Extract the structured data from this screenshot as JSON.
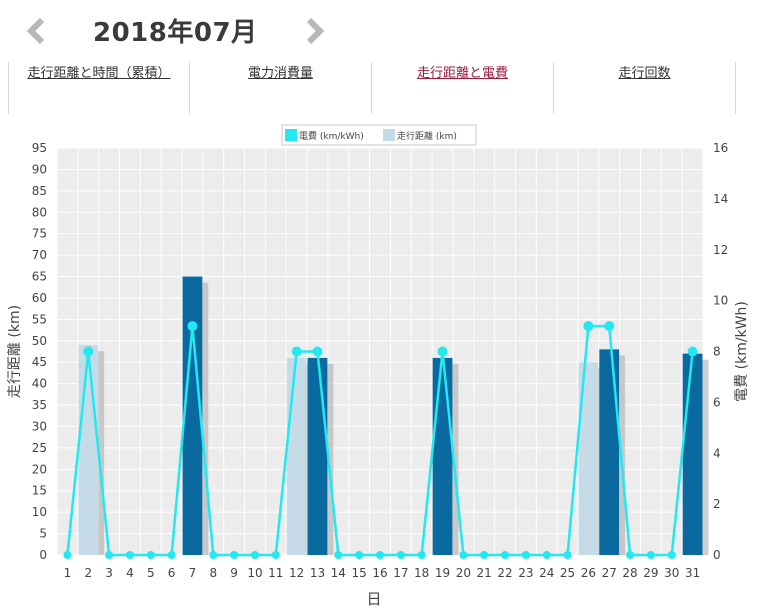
{
  "header": {
    "month_title": "2018年07月",
    "prev_icon": "chevron-left-icon",
    "next_icon": "chevron-right-icon"
  },
  "tabs": [
    {
      "label": "走行距離と時間（累積）",
      "active": false
    },
    {
      "label": "電力消費量",
      "active": false
    },
    {
      "label": "走行距離と電費",
      "active": true
    },
    {
      "label": "走行回数",
      "active": false
    }
  ],
  "colors": {
    "tab_text": "#333333",
    "tab_active": "#9b1c3c",
    "bar_dark": "#0a6aa0",
    "bar_light": "#c6dbe8",
    "line": "#22e8f0",
    "plot_bg": "#ececec",
    "grid": "#ffffff"
  },
  "chart_data": {
    "type": "bar",
    "legend": [
      "電費 (km/kWh)",
      "走行距離 (km)"
    ],
    "legend_position": "top-center",
    "xlabel": "日",
    "ylabel_left": "走行距離 (km)",
    "ylabel_right": "電費 (km/kWh)",
    "ylim_left": [
      0,
      95
    ],
    "ylim_right": [
      0,
      16
    ],
    "grid": true,
    "categories": [
      "1",
      "2",
      "3",
      "4",
      "5",
      "6",
      "7",
      "8",
      "9",
      "10",
      "11",
      "12",
      "13",
      "14",
      "15",
      "16",
      "17",
      "18",
      "19",
      "20",
      "21",
      "22",
      "23",
      "24",
      "25",
      "26",
      "27",
      "28",
      "29",
      "30",
      "31"
    ],
    "left_ticks": [
      "0",
      "5",
      "10",
      "15",
      "20",
      "25",
      "30",
      "35",
      "40",
      "45",
      "50",
      "55",
      "60",
      "65",
      "70",
      "75",
      "80",
      "85",
      "90",
      "95"
    ],
    "right_ticks": [
      "0",
      "2",
      "4",
      "6",
      "8",
      "10",
      "12",
      "14",
      "16"
    ],
    "series": [
      {
        "name": "走行距離 (km)",
        "kind": "bar",
        "values": [
          0,
          49,
          0,
          0,
          0,
          0,
          65,
          0,
          0,
          0,
          0,
          46,
          46,
          0,
          0,
          0,
          0,
          0,
          46,
          0,
          0,
          0,
          0,
          0,
          0,
          45,
          48,
          0,
          0,
          0,
          47
        ],
        "tone": [
          "light",
          "light",
          "light",
          "light",
          "light",
          "light",
          "dark",
          "light",
          "light",
          "light",
          "light",
          "light",
          "dark",
          "light",
          "light",
          "light",
          "light",
          "light",
          "dark",
          "light",
          "light",
          "light",
          "light",
          "light",
          "light",
          "light",
          "dark",
          "light",
          "light",
          "light",
          "dark"
        ]
      },
      {
        "name": "電費 (km/kWh)",
        "kind": "line",
        "values": [
          0,
          8,
          0,
          0,
          0,
          0,
          9,
          0,
          0,
          0,
          0,
          8,
          8,
          0,
          0,
          0,
          0,
          0,
          8,
          0,
          0,
          0,
          0,
          0,
          0,
          9,
          9,
          0,
          0,
          0,
          8
        ]
      }
    ]
  }
}
